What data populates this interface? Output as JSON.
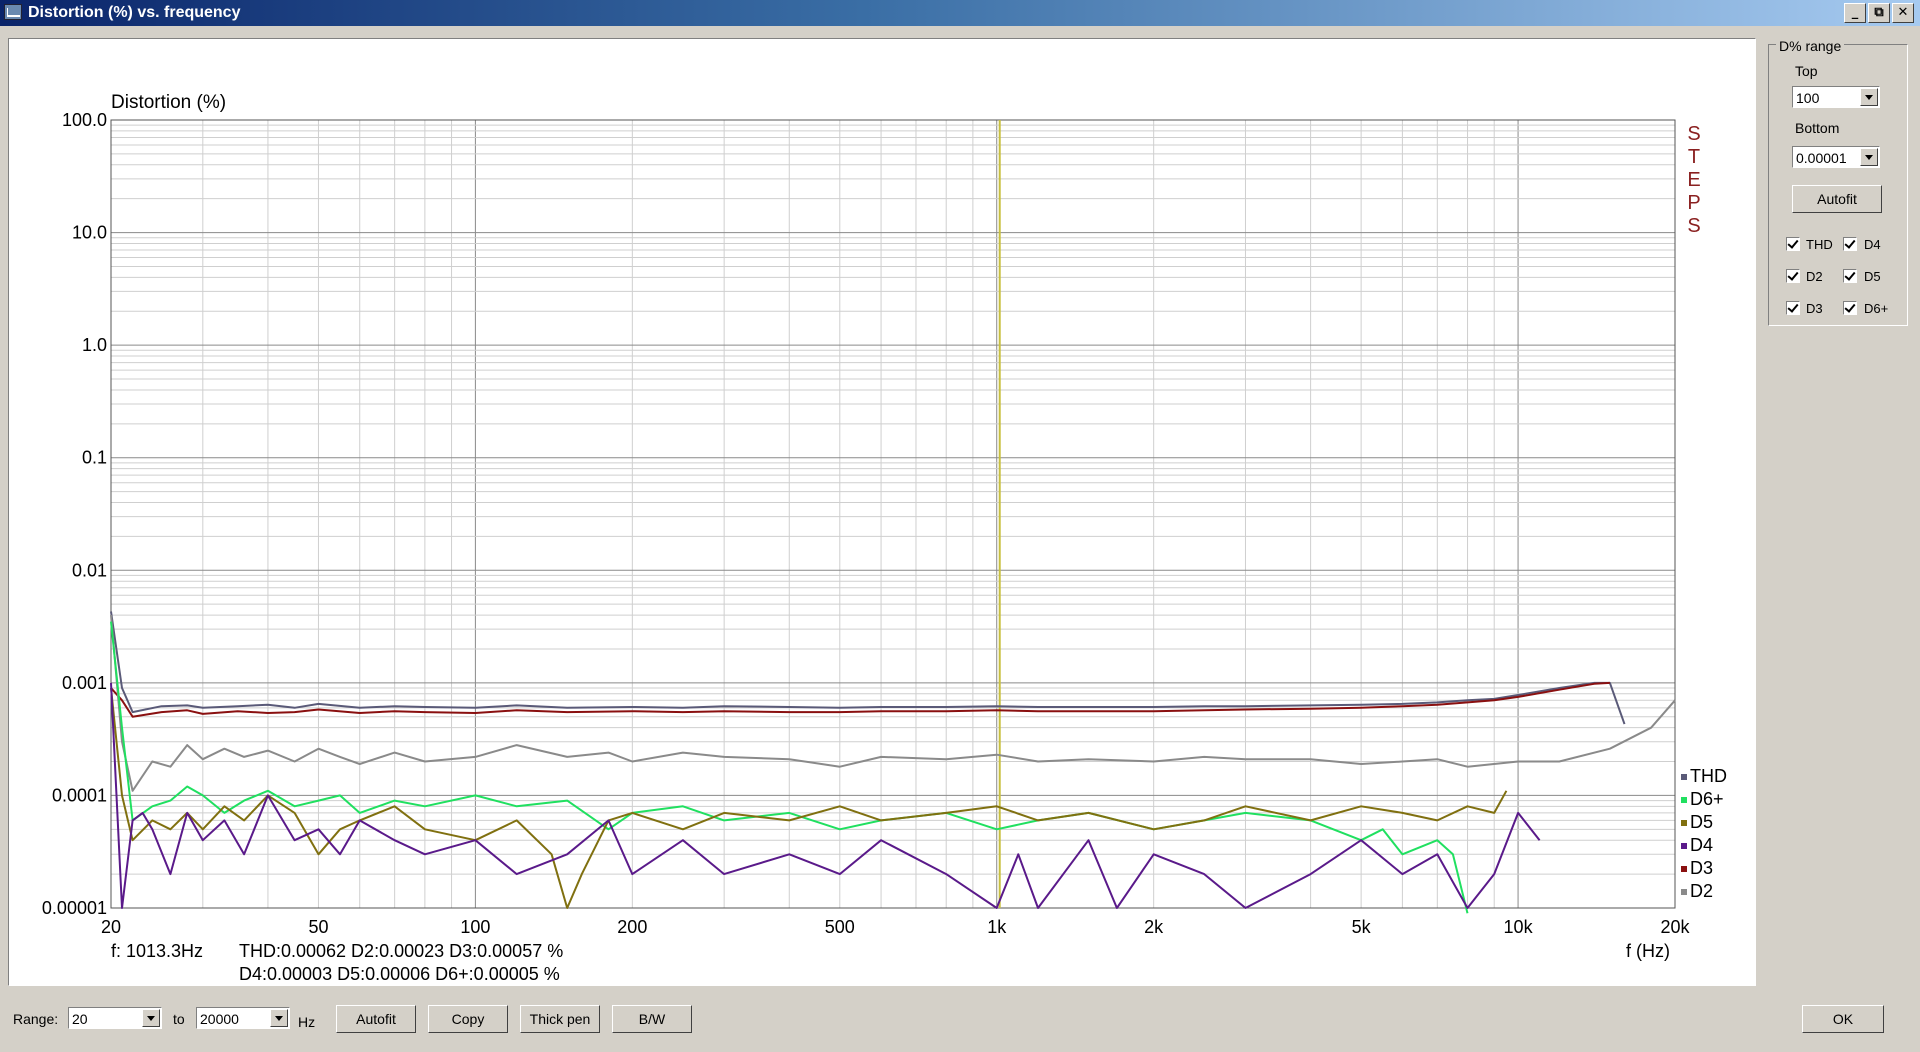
{
  "window": {
    "title": "Distortion (%) vs. frequency",
    "controls": [
      "_",
      "⧉",
      "✕"
    ]
  },
  "panel": {
    "group_title": "D% range",
    "top_label": "Top",
    "top_value": "100",
    "bottom_label": "Bottom",
    "bottom_value": "0.00001",
    "autofit_label": "Autofit",
    "checks": [
      {
        "label": "THD",
        "checked": true
      },
      {
        "label": "D4",
        "checked": true
      },
      {
        "label": "D2",
        "checked": true
      },
      {
        "label": "D5",
        "checked": true
      },
      {
        "label": "D3",
        "checked": true
      },
      {
        "label": "D6+",
        "checked": true
      }
    ]
  },
  "bottom_bar": {
    "range_label": "Range:",
    "range_from": "20",
    "to_label": "to",
    "range_to": "20000",
    "hz_label": "Hz",
    "autofit_label": "Autofit",
    "copy_label": "Copy",
    "thick_pen_label": "Thick pen",
    "bw_label": "B/W",
    "ok_label": "OK"
  },
  "readout": {
    "freq": "f:  1013.3Hz",
    "line1": "THD:0.00062   D2:0.00023   D3:0.00057 %",
    "line2": "D4:0.00003   D5:0.00006   D6+:0.00005 %"
  },
  "steps_label": [
    "S",
    "T",
    "E",
    "P",
    "S"
  ],
  "colors": {
    "THD": "#5a5a78",
    "D2": "#8a8a8a",
    "D3": "#8a1010",
    "D4": "#5a1a8a",
    "D5": "#807010",
    "D6+": "#20e060",
    "cursor": "#c8c040",
    "steps": "#8a2020"
  },
  "chart_data": {
    "type": "line",
    "ylabel": "Distortion (%)",
    "xlabel": "f (Hz)",
    "x_scale": "log",
    "y_scale": "log",
    "xlim": [
      20,
      20000
    ],
    "ylim": [
      1e-05,
      100
    ],
    "x_ticks": [
      {
        "value": 20,
        "label": "20"
      },
      {
        "value": 50,
        "label": "50"
      },
      {
        "value": 100,
        "label": "100"
      },
      {
        "value": 200,
        "label": "200"
      },
      {
        "value": 500,
        "label": "500"
      },
      {
        "value": 1000,
        "label": "1k"
      },
      {
        "value": 2000,
        "label": "2k"
      },
      {
        "value": 5000,
        "label": "5k"
      },
      {
        "value": 10000,
        "label": "10k"
      },
      {
        "value": 20000,
        "label": "20k"
      }
    ],
    "y_ticks": [
      {
        "value": 100,
        "label": "100.0"
      },
      {
        "value": 10,
        "label": "10.0"
      },
      {
        "value": 1,
        "label": "1.0"
      },
      {
        "value": 0.1,
        "label": "0.1"
      },
      {
        "value": 0.01,
        "label": "0.01"
      },
      {
        "value": 0.001,
        "label": "0.001"
      },
      {
        "value": 0.0001,
        "label": "0.0001"
      },
      {
        "value": 1e-05,
        "label": "0.00001"
      }
    ],
    "cursor_x": 1013.3,
    "grid": true,
    "legend_position": "bottom-right",
    "legend_order": [
      "THD",
      "D6+",
      "D5",
      "D4",
      "D3",
      "D2"
    ],
    "series": [
      {
        "name": "THD",
        "x": [
          20,
          21,
          22,
          25,
          28,
          30,
          35,
          40,
          45,
          50,
          60,
          70,
          80,
          100,
          120,
          150,
          200,
          250,
          300,
          400,
          500,
          600,
          800,
          1000,
          1200,
          1500,
          2000,
          2500,
          3000,
          4000,
          5000,
          6000,
          7000,
          8000,
          9000,
          10000,
          12000,
          14000,
          15000,
          16000
        ],
        "y": [
          0.0043,
          0.0009,
          0.00055,
          0.00062,
          0.00063,
          0.0006,
          0.00062,
          0.00064,
          0.0006,
          0.00065,
          0.0006,
          0.00062,
          0.00061,
          0.0006,
          0.00063,
          0.0006,
          0.00061,
          0.0006,
          0.00062,
          0.00061,
          0.0006,
          0.00061,
          0.00061,
          0.00062,
          0.00061,
          0.00061,
          0.00061,
          0.00062,
          0.00062,
          0.00063,
          0.00064,
          0.00065,
          0.00067,
          0.0007,
          0.00072,
          0.00078,
          0.0009,
          0.001,
          0.001,
          0.00043
        ]
      },
      {
        "name": "D3",
        "x": [
          20,
          21,
          22,
          25,
          28,
          30,
          35,
          40,
          45,
          50,
          60,
          70,
          80,
          100,
          120,
          150,
          200,
          250,
          300,
          400,
          500,
          600,
          800,
          1000,
          1200,
          1500,
          2000,
          2500,
          3000,
          4000,
          5000,
          6000,
          7000,
          8000,
          9000,
          10000,
          12000,
          14000,
          15000
        ],
        "y": [
          0.0009,
          0.0007,
          0.0005,
          0.00055,
          0.00057,
          0.00053,
          0.00056,
          0.00054,
          0.00055,
          0.00058,
          0.00054,
          0.00056,
          0.00055,
          0.00054,
          0.00057,
          0.00055,
          0.00056,
          0.00055,
          0.00056,
          0.00055,
          0.00055,
          0.00056,
          0.00056,
          0.00057,
          0.00056,
          0.00056,
          0.00056,
          0.00057,
          0.00058,
          0.00059,
          0.0006,
          0.00062,
          0.00064,
          0.00067,
          0.0007,
          0.00075,
          0.00087,
          0.00098,
          0.001
        ]
      },
      {
        "name": "D2",
        "x": [
          20,
          21,
          22,
          24,
          26,
          28,
          30,
          33,
          36,
          40,
          45,
          50,
          55,
          60,
          70,
          80,
          100,
          120,
          150,
          180,
          200,
          250,
          300,
          400,
          500,
          600,
          800,
          1000,
          1200,
          1500,
          2000,
          2500,
          3000,
          4000,
          5000,
          6000,
          7000,
          8000,
          10000,
          12000,
          15000,
          18000,
          20000
        ],
        "y": [
          0.004,
          0.0003,
          0.00011,
          0.0002,
          0.00018,
          0.00028,
          0.00021,
          0.00026,
          0.00022,
          0.00025,
          0.0002,
          0.00026,
          0.00022,
          0.00019,
          0.00024,
          0.0002,
          0.00022,
          0.00028,
          0.00022,
          0.00024,
          0.0002,
          0.00024,
          0.00022,
          0.00021,
          0.00018,
          0.00022,
          0.00021,
          0.00023,
          0.0002,
          0.00021,
          0.0002,
          0.00022,
          0.00021,
          0.00021,
          0.00019,
          0.0002,
          0.00021,
          0.00018,
          0.0002,
          0.0002,
          0.00026,
          0.0004,
          0.0007
        ]
      },
      {
        "name": "D6+",
        "x": [
          20,
          21,
          22,
          24,
          26,
          28,
          30,
          33,
          36,
          40,
          45,
          50,
          55,
          60,
          70,
          80,
          100,
          120,
          150,
          180,
          200,
          250,
          300,
          400,
          500,
          600,
          800,
          1000,
          1200,
          1500,
          2000,
          2500,
          3000,
          4000,
          5000,
          5500,
          6000,
          7000,
          7500,
          8000
        ],
        "y": [
          0.0035,
          0.0004,
          6e-05,
          8e-05,
          9e-05,
          0.00012,
          0.0001,
          7e-05,
          9e-05,
          0.00011,
          8e-05,
          9e-05,
          0.0001,
          7e-05,
          9e-05,
          8e-05,
          0.0001,
          8e-05,
          9e-05,
          5e-05,
          7e-05,
          8e-05,
          6e-05,
          7e-05,
          5e-05,
          6e-05,
          7e-05,
          5e-05,
          6e-05,
          7e-05,
          5e-05,
          6e-05,
          7e-05,
          6e-05,
          4e-05,
          5e-05,
          3e-05,
          4e-05,
          3e-05,
          9e-06
        ]
      },
      {
        "name": "D5",
        "x": [
          20,
          21,
          22,
          24,
          26,
          28,
          30,
          33,
          36,
          40,
          45,
          50,
          55,
          60,
          70,
          80,
          100,
          120,
          140,
          150,
          160,
          180,
          200,
          250,
          300,
          400,
          500,
          600,
          800,
          1000,
          1200,
          1500,
          2000,
          2500,
          3000,
          4000,
          5000,
          6000,
          7000,
          8000,
          9000,
          9500
        ],
        "y": [
          0.0009,
          0.0001,
          4e-05,
          6e-05,
          5e-05,
          7e-05,
          5e-05,
          8e-05,
          6e-05,
          0.0001,
          7e-05,
          3e-05,
          5e-05,
          6e-05,
          8e-05,
          5e-05,
          4e-05,
          6e-05,
          3e-05,
          1e-05,
          2e-05,
          6e-05,
          7e-05,
          5e-05,
          7e-05,
          6e-05,
          8e-05,
          6e-05,
          7e-05,
          8e-05,
          6e-05,
          7e-05,
          5e-05,
          6e-05,
          8e-05,
          6e-05,
          8e-05,
          7e-05,
          6e-05,
          8e-05,
          7e-05,
          0.00011
        ]
      },
      {
        "name": "D4",
        "x": [
          20,
          21,
          22,
          23,
          24,
          26,
          28,
          30,
          33,
          36,
          40,
          45,
          50,
          55,
          60,
          70,
          80,
          100,
          120,
          150,
          180,
          200,
          250,
          300,
          400,
          500,
          600,
          800,
          1000,
          1100,
          1200,
          1500,
          1700,
          2000,
          2500,
          3000,
          4000,
          5000,
          6000,
          7000,
          8000,
          9000,
          10000,
          11000
        ],
        "y": [
          0.001,
          1e-05,
          6e-05,
          7e-05,
          5e-05,
          2e-05,
          7e-05,
          4e-05,
          6e-05,
          3e-05,
          0.0001,
          4e-05,
          5e-05,
          3e-05,
          6e-05,
          4e-05,
          3e-05,
          4e-05,
          2e-05,
          3e-05,
          6e-05,
          2e-05,
          4e-05,
          2e-05,
          3e-05,
          2e-05,
          4e-05,
          2e-05,
          1e-05,
          3e-05,
          1e-05,
          4e-05,
          1e-05,
          3e-05,
          2e-05,
          1e-05,
          2e-05,
          4e-05,
          2e-05,
          3e-05,
          1e-05,
          2e-05,
          7e-05,
          4e-05
        ]
      }
    ]
  }
}
